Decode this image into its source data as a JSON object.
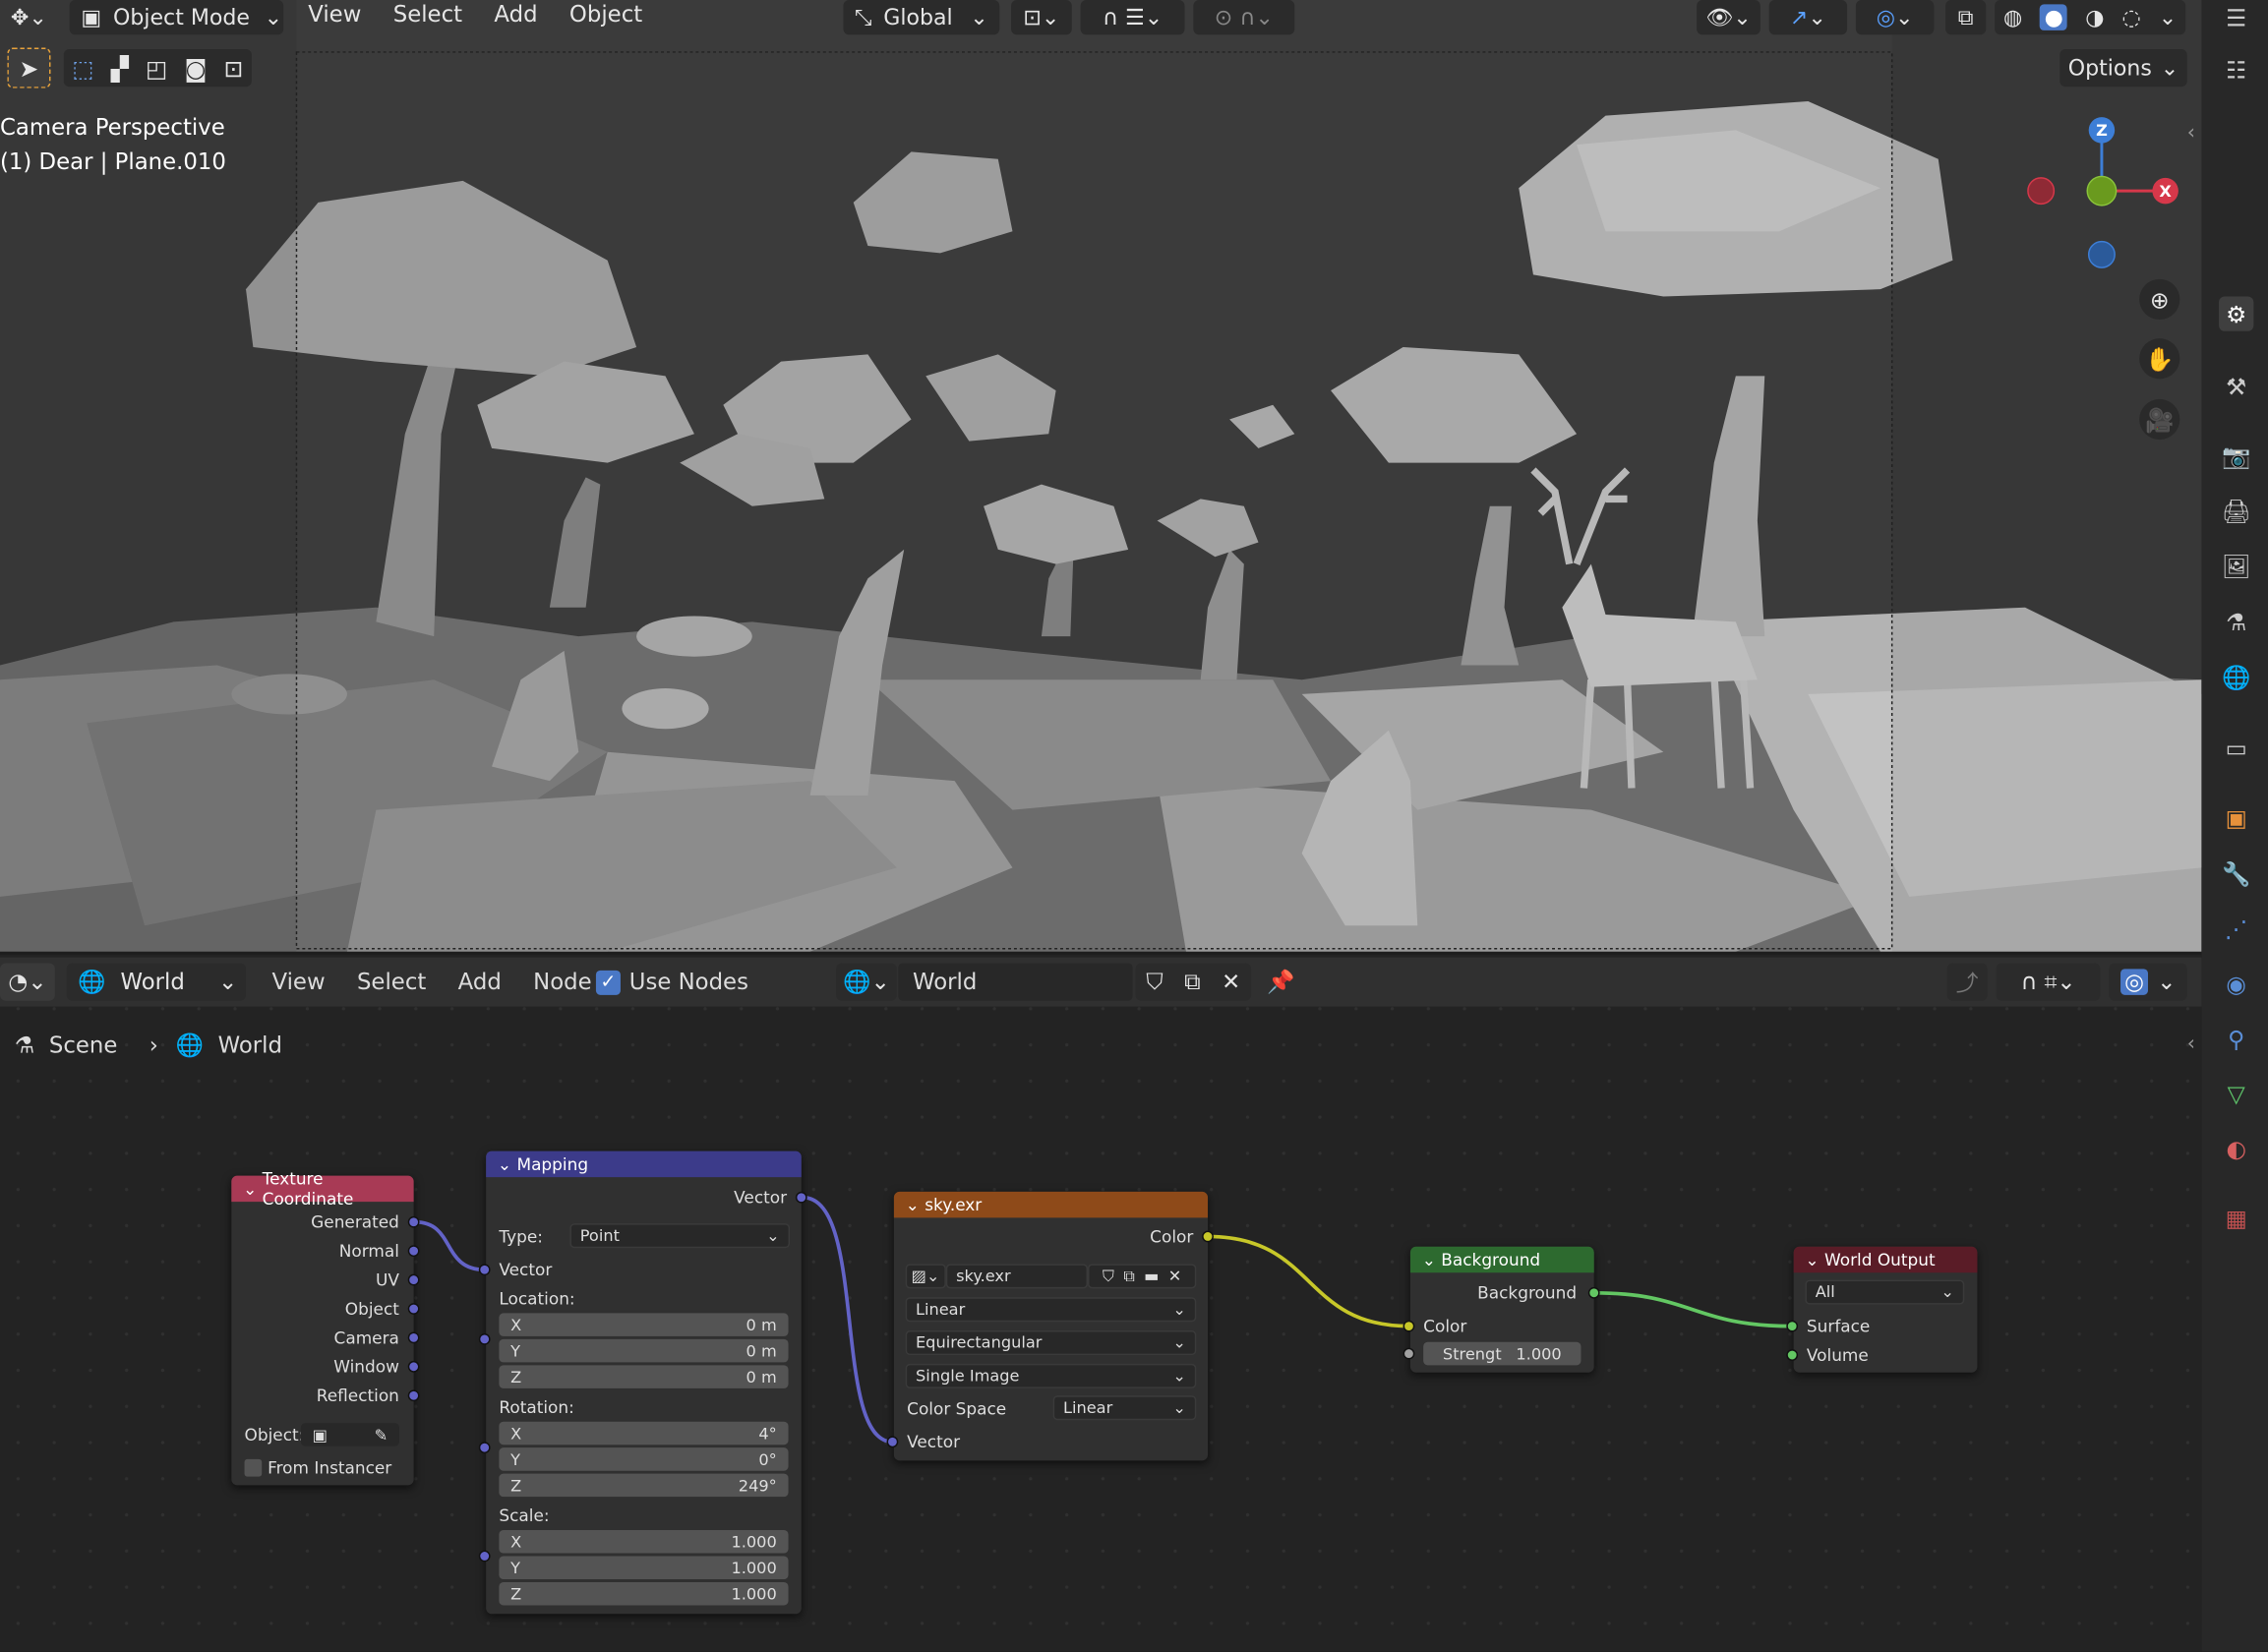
{
  "viewport": {
    "mode_label": "Object Mode",
    "menus": [
      "View",
      "Select",
      "Add",
      "Object"
    ],
    "transform_orientation": "Global",
    "options_label": "Options",
    "overlay_line1": "Camera Perspective",
    "overlay_line2": "(1) Dear | Plane.010",
    "gizmo": {
      "z": "Z",
      "x": "X"
    }
  },
  "node_editor": {
    "world_selector": "World",
    "menus": [
      "View",
      "Select",
      "Add",
      "Node"
    ],
    "use_nodes_label": "Use Nodes",
    "use_nodes_checked": true,
    "datablock_name": "World",
    "breadcrumb": {
      "scene": "Scene",
      "world": "World"
    }
  },
  "nodes": {
    "texcoord": {
      "title": "Texture Coordinate",
      "outputs": [
        "Generated",
        "Normal",
        "UV",
        "Object",
        "Camera",
        "Window",
        "Reflection"
      ],
      "object_label": "Object:",
      "from_instancer": "From Instancer",
      "color": "#a83a55"
    },
    "mapping": {
      "title": "Mapping",
      "output": "Vector",
      "type_label": "Type:",
      "type_value": "Point",
      "vector_input": "Vector",
      "location_label": "Location:",
      "location": [
        {
          "axis": "X",
          "value": "0 m"
        },
        {
          "axis": "Y",
          "value": "0 m"
        },
        {
          "axis": "Z",
          "value": "0 m"
        }
      ],
      "rotation_label": "Rotation:",
      "rotation": [
        {
          "axis": "X",
          "value": "4°"
        },
        {
          "axis": "Y",
          "value": "0°"
        },
        {
          "axis": "Z",
          "value": "249°"
        }
      ],
      "scale_label": "Scale:",
      "scale": [
        {
          "axis": "X",
          "value": "1.000"
        },
        {
          "axis": "Y",
          "value": "1.000"
        },
        {
          "axis": "Z",
          "value": "1.000"
        }
      ],
      "color": "#3c3b8a"
    },
    "image": {
      "title": "sky.exr",
      "output": "Color",
      "image_name": "sky.exr",
      "interpolation": "Linear",
      "projection": "Equirectangular",
      "source": "Single Image",
      "color_space_label": "Color Space",
      "color_space": "Linear",
      "vector_input": "Vector",
      "color": "#8e4a19"
    },
    "background": {
      "title": "Background",
      "output": "Background",
      "color_input": "Color",
      "strength_label": "Strengt",
      "strength_value": "1.000",
      "color": "#2d6a2f"
    },
    "output": {
      "title": "World Output",
      "target": "All",
      "surface": "Surface",
      "volume": "Volume",
      "color": "#5a1c27"
    }
  },
  "colors": {
    "vector_socket": "#6363c7",
    "color_socket": "#c7c729",
    "shader_socket": "#63c763",
    "grey_socket": "#a1a1a1"
  }
}
